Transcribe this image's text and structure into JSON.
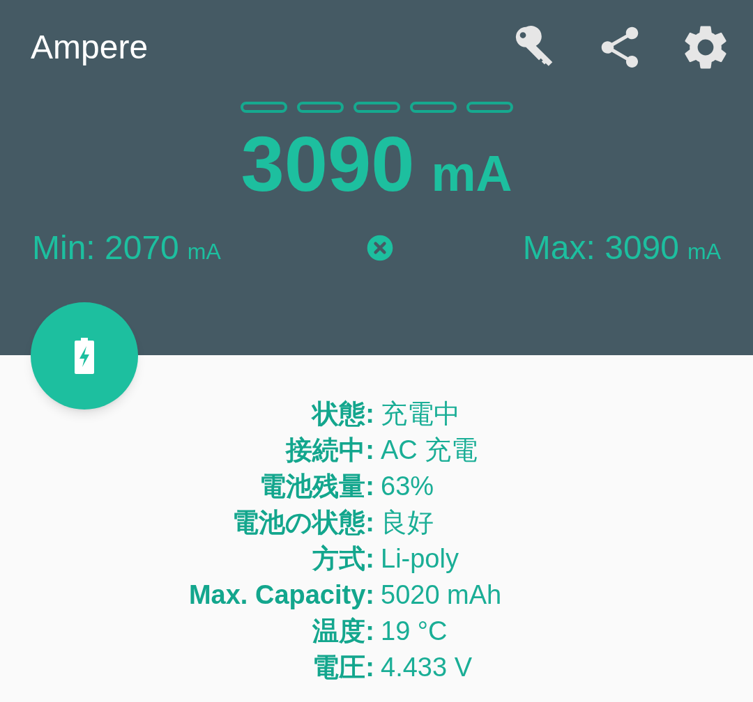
{
  "app_bar": {
    "title": "Ampere"
  },
  "segments": [
    {
      "filled": false
    },
    {
      "filled": false
    },
    {
      "filled": false
    },
    {
      "filled": false
    },
    {
      "filled": false
    }
  ],
  "current": {
    "value": "3090",
    "unit": "mA"
  },
  "min": {
    "label": "Min: 2070",
    "unit": "mA"
  },
  "max": {
    "label": "Max: 3090",
    "unit": "mA"
  },
  "info": [
    {
      "label": "状態:",
      "value": "充電中"
    },
    {
      "label": "接続中:",
      "value": "AC 充電"
    },
    {
      "label": "電池残量:",
      "value": "63%"
    },
    {
      "label": "電池の状態:",
      "value": "良好"
    },
    {
      "label": "方式:",
      "value": "Li-poly"
    },
    {
      "label": "Max. Capacity:",
      "value": "5020 mAh"
    },
    {
      "label": "温度:",
      "value": "19 °C"
    },
    {
      "label": "電圧:",
      "value": "4.433 V"
    }
  ]
}
